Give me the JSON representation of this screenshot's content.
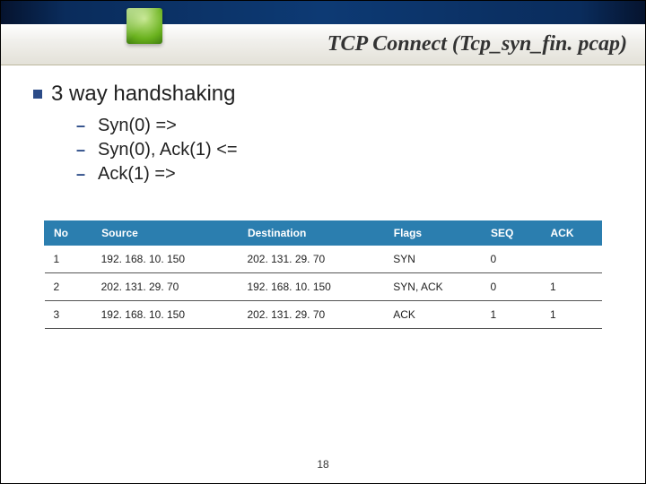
{
  "header": {
    "title": "TCP Connect (Tcp_syn_fin. pcap)"
  },
  "heading": "3 way handshaking",
  "bullets": [
    "Syn(0)   =>",
    "Syn(0), Ack(1)  <=",
    "Ack(1) =>"
  ],
  "table": {
    "headers": [
      "No",
      "Source",
      "Destination",
      "Flags",
      "SEQ",
      "ACK"
    ],
    "rows": [
      [
        "1",
        "192. 168. 10. 150",
        "202. 131. 29. 70",
        "SYN",
        "0",
        ""
      ],
      [
        "2",
        "202. 131. 29. 70",
        "192. 168. 10. 150",
        "SYN, ACK",
        "0",
        "1"
      ],
      [
        "3",
        "192. 168. 10. 150",
        "202. 131. 29. 70",
        "ACK",
        "1",
        "1"
      ]
    ]
  },
  "page_number": "18"
}
